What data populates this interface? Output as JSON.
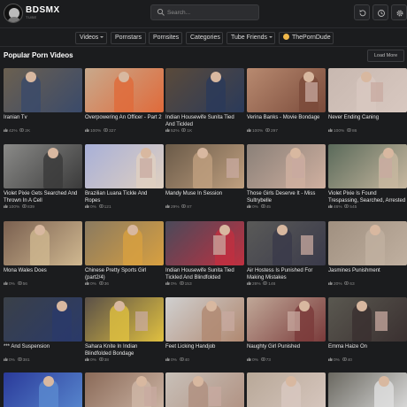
{
  "brand": {
    "name": "BDSMX",
    "sub": "TUBE"
  },
  "search": {
    "placeholder": "Search..."
  },
  "nav": [
    {
      "label": "Videos",
      "dropdown": true
    },
    {
      "label": "Pornstars",
      "dropdown": false
    },
    {
      "label": "Pornsites",
      "dropdown": false
    },
    {
      "label": "Categories",
      "dropdown": false
    },
    {
      "label": "Tube Friends",
      "dropdown": true
    },
    {
      "label": "ThePornDude",
      "dropdown": false
    }
  ],
  "section": {
    "title": "Popular Porn Videos",
    "load_more": "Load More"
  },
  "videos": [
    {
      "title": "Iranian Tv",
      "rating": "42%",
      "views": "2K",
      "bg": "#6b6050",
      "accent": "#3a4a6a"
    },
    {
      "title": "Overpowering An Officer - Part 2",
      "rating": "100%",
      "views": "327",
      "bg": "#c8a98c",
      "accent": "#e06a3a"
    },
    {
      "title": "Indian Housewife Sunita Tied And Tickled",
      "rating": "52%",
      "views": "1K",
      "bg": "#5a4a3a",
      "accent": "#2a3a5a"
    },
    {
      "title": "Verina Banks - Movie Bondage",
      "rating": "100%",
      "views": "297",
      "bg": "#b88a70",
      "accent": "#7a4a3a"
    },
    {
      "title": "Never Ending Caning",
      "rating": "100%",
      "views": "86",
      "bg": "#c8b8b0",
      "accent": "#d8c8c0"
    },
    {
      "title": "Violet Pixie Gets Searched And Thrown In A Cell",
      "rating": "100%",
      "views": "839",
      "bg": "#8a8a88",
      "accent": "#3a3a3a"
    },
    {
      "title": "Brazilian Luana Tickle And Ropes",
      "rating": "0%",
      "views": "121",
      "bg": "#a8b0d8",
      "accent": "#e0d0c0"
    },
    {
      "title": "Mandy Muse In Session",
      "rating": "29%",
      "views": "87",
      "bg": "#6a5a48",
      "accent": "#c0a080"
    },
    {
      "title": "Those Girls Deserve It - Miss Sultrybelle",
      "rating": "0%",
      "views": "45",
      "bg": "#8a8078",
      "accent": "#d0b0a0"
    },
    {
      "title": "Violet Pixie Is Found Trespassing, Searched, Arrested",
      "rating": "46%",
      "views": "545",
      "bg": "#5a6a5a",
      "accent": "#c8b8a0"
    },
    {
      "title": "Mona Wales Does",
      "rating": "0%",
      "views": "56",
      "bg": "#7a6050",
      "accent": "#d0b890"
    },
    {
      "title": "Chinese Pretty Sports Girl (part2/4)",
      "rating": "0%",
      "views": "36",
      "bg": "#8a7a60",
      "accent": "#d8a040"
    },
    {
      "title": "Indian Housewife Sunita Tied Tickled And Blindfolded",
      "rating": "0%",
      "views": "153",
      "bg": "#4a4a5a",
      "accent": "#c03040"
    },
    {
      "title": "Air Hostess Is Punished For Making Mistakes",
      "rating": "26%",
      "views": "146",
      "bg": "#5a5a58",
      "accent": "#3a3a4a"
    },
    {
      "title": "Jasmines Punishment",
      "rating": "20%",
      "views": "63",
      "bg": "#a09080",
      "accent": "#c0b0a0"
    },
    {
      "title": "*** And Suspension",
      "rating": "0%",
      "views": "381",
      "bg": "#3a4048",
      "accent": "#2a3a6a"
    },
    {
      "title": "Sahara Knite In Indian Blindfolded Bondage",
      "rating": "0%",
      "views": "38",
      "bg": "#5a5048",
      "accent": "#e0c040"
    },
    {
      "title": "Feet Licking Handjob",
      "rating": "0%",
      "views": "40",
      "bg": "#d0d0d0",
      "accent": "#b08870"
    },
    {
      "title": "Naughty Girl Punished",
      "rating": "0%",
      "views": "73",
      "bg": "#c0a898",
      "accent": "#7a3a3a"
    },
    {
      "title": "Emma Haize On",
      "rating": "0%",
      "views": "40",
      "bg": "#5a5850",
      "accent": "#3a3030"
    },
    {
      "title": "",
      "rating": "",
      "views": "",
      "bg": "#2a3a9a",
      "accent": "#5a8ad0"
    },
    {
      "title": "",
      "rating": "",
      "views": "",
      "bg": "#8a6a58",
      "accent": "#d0b8a8"
    },
    {
      "title": "",
      "rating": "",
      "views": "",
      "bg": "#c8c0b8",
      "accent": "#b09080"
    },
    {
      "title": "",
      "rating": "",
      "views": "",
      "bg": "#b8a898",
      "accent": "#d8c8c0"
    },
    {
      "title": "",
      "rating": "",
      "views": "",
      "bg": "#6a6860",
      "accent": "#e0e0e0"
    }
  ]
}
